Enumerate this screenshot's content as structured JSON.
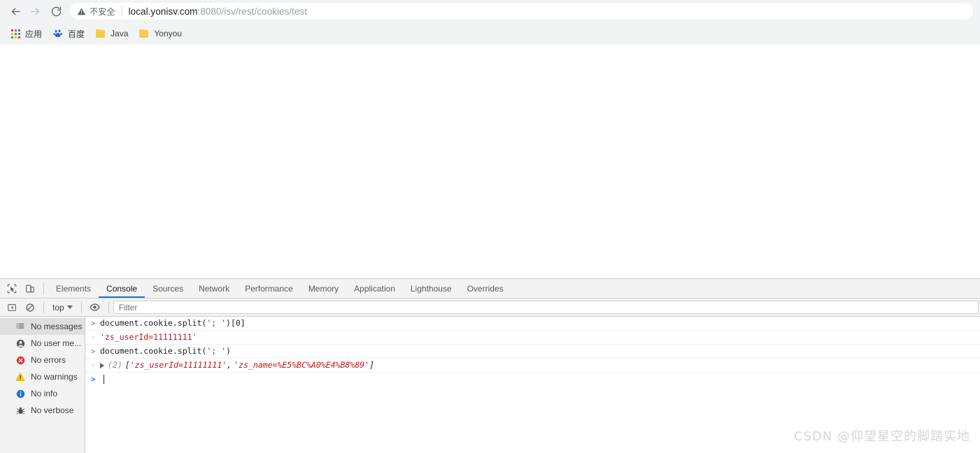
{
  "browser": {
    "nav": {
      "back_icon": "arrow-left-icon",
      "forward_icon": "arrow-right-icon",
      "reload_icon": "reload-icon"
    },
    "omnibox": {
      "security_icon": "warning-triangle-icon",
      "security_text": "不安全",
      "url_host": "local.yonisv.com",
      "url_path": ":8080/isv/rest/cookies/test",
      "url_full": "local.yonisv.com:8080/isv/rest/cookies/test"
    },
    "bookmarks": [
      {
        "label": "应用",
        "icon": "apps-grid-icon"
      },
      {
        "label": "百度",
        "icon": "baidu-paw-icon"
      },
      {
        "label": "Java",
        "icon": "folder-icon"
      },
      {
        "label": "Yonyou",
        "icon": "folder-icon"
      }
    ]
  },
  "devtools": {
    "toolbar_icons": [
      {
        "name": "inspect-element-icon"
      },
      {
        "name": "device-toolbar-icon"
      }
    ],
    "tabs": [
      {
        "label": "Elements",
        "active": false
      },
      {
        "label": "Console",
        "active": true
      },
      {
        "label": "Sources",
        "active": false
      },
      {
        "label": "Network",
        "active": false
      },
      {
        "label": "Performance",
        "active": false
      },
      {
        "label": "Memory",
        "active": false
      },
      {
        "label": "Application",
        "active": false
      },
      {
        "label": "Lighthouse",
        "active": false
      },
      {
        "label": "Overrides",
        "active": false
      }
    ],
    "filterbar": {
      "sidebar_toggle_icon": "show-console-sidebar-icon",
      "clear_icon": "clear-console-icon",
      "context": "top",
      "context_caret": "chevron-down-icon",
      "live_expression_icon": "eye-icon",
      "filter_placeholder": "Filter",
      "filter_value": ""
    },
    "sidebar": [
      {
        "label": "No messages",
        "icon": "list-icon",
        "selected": true
      },
      {
        "label": "No user me...",
        "icon": "user-icon",
        "selected": false
      },
      {
        "label": "No errors",
        "icon": "error-icon",
        "selected": false
      },
      {
        "label": "No warnings",
        "icon": "warning-icon",
        "selected": false
      },
      {
        "label": "No info",
        "icon": "info-icon",
        "selected": false
      },
      {
        "label": "No verbose",
        "icon": "bug-icon",
        "selected": false
      }
    ],
    "console_lines": [
      {
        "kind": "input",
        "gutter": ">",
        "code_pre": "document.cookie.split(",
        "code_str": "'; '",
        "code_post": ")[0]"
      },
      {
        "kind": "output",
        "gutter": "‹",
        "value": "'zs_userId=11111111'"
      },
      {
        "kind": "input",
        "gutter": ">",
        "code_pre": "document.cookie.split(",
        "code_str": "'; '",
        "code_post": ")"
      },
      {
        "kind": "output_array",
        "gutter": "‹",
        "disclosure_icon": "triangle-right-icon",
        "count": "(2)",
        "open_bracket": "[",
        "items": [
          "'zs_userId=11111111'",
          "'zs_name=%E5%BC%A0%E4%B8%89'"
        ],
        "separator": ", ",
        "close_bracket": "]"
      },
      {
        "kind": "prompt",
        "gutter": ">",
        "value": ""
      }
    ]
  },
  "watermark": "CSDN @仰望星空的脚踏实地",
  "colors": {
    "accent_blue": "#1a73e8",
    "string_red": "#c41a16",
    "error_red": "#ee2b2b",
    "warning_yellow": "#f5c518",
    "info_blue": "#1a73e8",
    "folder_yellow": "#f7cb4d",
    "chrome_gray": "#f1f3f4",
    "devtools_gray": "#f3f3f3"
  }
}
